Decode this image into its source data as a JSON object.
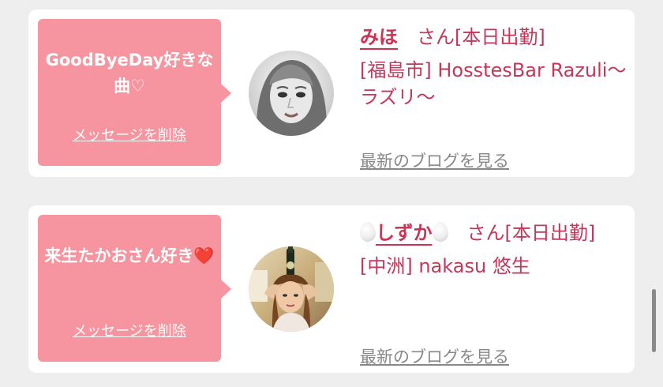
{
  "entries": [
    {
      "message": "GoodByeDay好きな曲♡",
      "delete_label": "メッセージを削除",
      "name": "みほ",
      "honorific": "さん[本日出勤]",
      "shop": "[福島市] HosstesBar Razuli～ラズリ～",
      "blog_link": "最新のブログを見る"
    },
    {
      "message_text": "来生たかおさん好き",
      "message_emoji": "❤️",
      "delete_label": "メッセージを削除",
      "name": "しずか",
      "honorific": "さん[本日出勤]",
      "shop": "[中洲] nakasu 悠生",
      "blog_link": "最新のブログを見る"
    }
  ],
  "colors": {
    "bubble": "#f6949f",
    "name": "#cc3355",
    "text": "#c2375a",
    "link_gray": "#888888"
  },
  "icons": {
    "heart": "red-heart-icon",
    "egg": "egg-icon"
  }
}
